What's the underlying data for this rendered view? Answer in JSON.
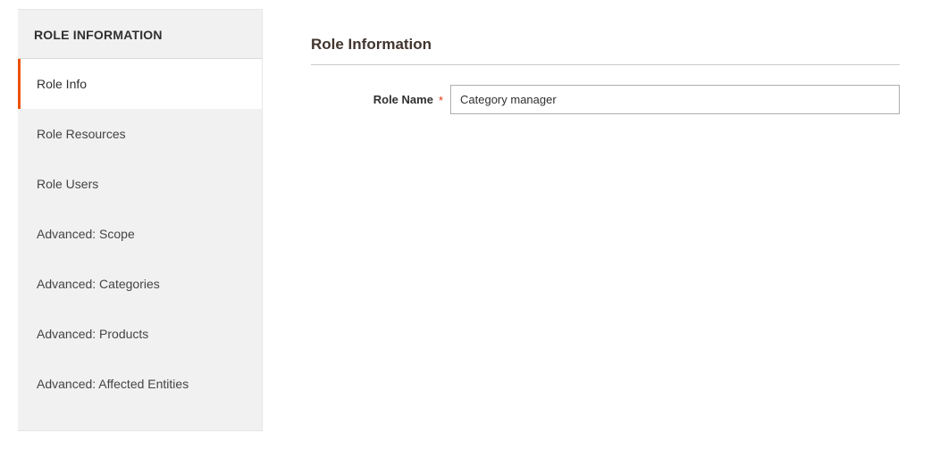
{
  "sidebar": {
    "header": "ROLE INFORMATION",
    "items": [
      {
        "label": "Role Info",
        "active": true
      },
      {
        "label": "Role Resources",
        "active": false
      },
      {
        "label": "Role Users",
        "active": false
      },
      {
        "label": "Advanced: Scope",
        "active": false
      },
      {
        "label": "Advanced: Categories",
        "active": false
      },
      {
        "label": "Advanced: Products",
        "active": false
      },
      {
        "label": "Advanced: Affected Entities",
        "active": false
      }
    ]
  },
  "main": {
    "section_title": "Role Information",
    "role_name_label": "Role Name",
    "role_name_value": "Category manager",
    "required_marker": "*"
  }
}
